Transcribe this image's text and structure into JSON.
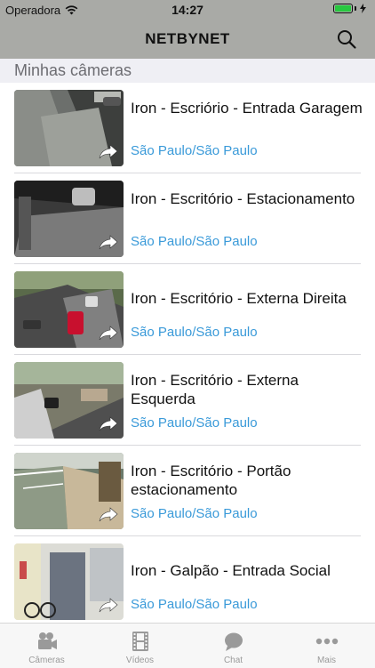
{
  "status_bar": {
    "carrier": "Operadora",
    "time": "14:27"
  },
  "header": {
    "title": "NETBYNET"
  },
  "section": {
    "title": "Minhas câmeras"
  },
  "cameras": [
    {
      "name": "Iron - Escriório - Entrada Garagem",
      "location": "São Paulo/São Paulo"
    },
    {
      "name": "Iron - Escritório - Estacionamento",
      "location": "São Paulo/São Paulo"
    },
    {
      "name": "Iron - Escritório - Externa Direita",
      "location": "São Paulo/São Paulo"
    },
    {
      "name": "Iron - Escritório - Externa Esquerda",
      "location": "São Paulo/São Paulo"
    },
    {
      "name": "Iron - Escritório - Portão estacionamento",
      "location": "São Paulo/São Paulo"
    },
    {
      "name": "Iron - Galpão - Entrada Social",
      "location": "São Paulo/São Paulo"
    }
  ],
  "tabs": [
    {
      "label": "Câmeras",
      "icon": "video-camera-icon"
    },
    {
      "label": "Vídeos",
      "icon": "film-icon"
    },
    {
      "label": "Chat",
      "icon": "chat-bubble-icon"
    },
    {
      "label": "Mais",
      "icon": "more-dots-icon"
    }
  ],
  "colors": {
    "bar": "#a9aaa6",
    "accent_location": "#3a9ad9",
    "tab_inactive": "#9a9a9a"
  }
}
